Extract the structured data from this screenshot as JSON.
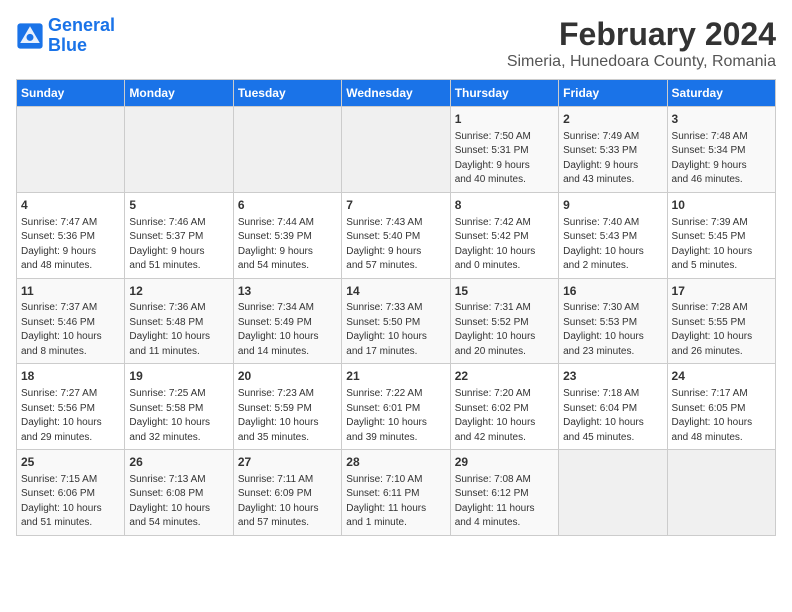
{
  "header": {
    "logo_line1": "General",
    "logo_line2": "Blue",
    "title": "February 2024",
    "subtitle": "Simeria, Hunedoara County, Romania"
  },
  "weekdays": [
    "Sunday",
    "Monday",
    "Tuesday",
    "Wednesday",
    "Thursday",
    "Friday",
    "Saturday"
  ],
  "weeks": [
    [
      {
        "day": "",
        "info": ""
      },
      {
        "day": "",
        "info": ""
      },
      {
        "day": "",
        "info": ""
      },
      {
        "day": "",
        "info": ""
      },
      {
        "day": "1",
        "info": "Sunrise: 7:50 AM\nSunset: 5:31 PM\nDaylight: 9 hours\nand 40 minutes."
      },
      {
        "day": "2",
        "info": "Sunrise: 7:49 AM\nSunset: 5:33 PM\nDaylight: 9 hours\nand 43 minutes."
      },
      {
        "day": "3",
        "info": "Sunrise: 7:48 AM\nSunset: 5:34 PM\nDaylight: 9 hours\nand 46 minutes."
      }
    ],
    [
      {
        "day": "4",
        "info": "Sunrise: 7:47 AM\nSunset: 5:36 PM\nDaylight: 9 hours\nand 48 minutes."
      },
      {
        "day": "5",
        "info": "Sunrise: 7:46 AM\nSunset: 5:37 PM\nDaylight: 9 hours\nand 51 minutes."
      },
      {
        "day": "6",
        "info": "Sunrise: 7:44 AM\nSunset: 5:39 PM\nDaylight: 9 hours\nand 54 minutes."
      },
      {
        "day": "7",
        "info": "Sunrise: 7:43 AM\nSunset: 5:40 PM\nDaylight: 9 hours\nand 57 minutes."
      },
      {
        "day": "8",
        "info": "Sunrise: 7:42 AM\nSunset: 5:42 PM\nDaylight: 10 hours\nand 0 minutes."
      },
      {
        "day": "9",
        "info": "Sunrise: 7:40 AM\nSunset: 5:43 PM\nDaylight: 10 hours\nand 2 minutes."
      },
      {
        "day": "10",
        "info": "Sunrise: 7:39 AM\nSunset: 5:45 PM\nDaylight: 10 hours\nand 5 minutes."
      }
    ],
    [
      {
        "day": "11",
        "info": "Sunrise: 7:37 AM\nSunset: 5:46 PM\nDaylight: 10 hours\nand 8 minutes."
      },
      {
        "day": "12",
        "info": "Sunrise: 7:36 AM\nSunset: 5:48 PM\nDaylight: 10 hours\nand 11 minutes."
      },
      {
        "day": "13",
        "info": "Sunrise: 7:34 AM\nSunset: 5:49 PM\nDaylight: 10 hours\nand 14 minutes."
      },
      {
        "day": "14",
        "info": "Sunrise: 7:33 AM\nSunset: 5:50 PM\nDaylight: 10 hours\nand 17 minutes."
      },
      {
        "day": "15",
        "info": "Sunrise: 7:31 AM\nSunset: 5:52 PM\nDaylight: 10 hours\nand 20 minutes."
      },
      {
        "day": "16",
        "info": "Sunrise: 7:30 AM\nSunset: 5:53 PM\nDaylight: 10 hours\nand 23 minutes."
      },
      {
        "day": "17",
        "info": "Sunrise: 7:28 AM\nSunset: 5:55 PM\nDaylight: 10 hours\nand 26 minutes."
      }
    ],
    [
      {
        "day": "18",
        "info": "Sunrise: 7:27 AM\nSunset: 5:56 PM\nDaylight: 10 hours\nand 29 minutes."
      },
      {
        "day": "19",
        "info": "Sunrise: 7:25 AM\nSunset: 5:58 PM\nDaylight: 10 hours\nand 32 minutes."
      },
      {
        "day": "20",
        "info": "Sunrise: 7:23 AM\nSunset: 5:59 PM\nDaylight: 10 hours\nand 35 minutes."
      },
      {
        "day": "21",
        "info": "Sunrise: 7:22 AM\nSunset: 6:01 PM\nDaylight: 10 hours\nand 39 minutes."
      },
      {
        "day": "22",
        "info": "Sunrise: 7:20 AM\nSunset: 6:02 PM\nDaylight: 10 hours\nand 42 minutes."
      },
      {
        "day": "23",
        "info": "Sunrise: 7:18 AM\nSunset: 6:04 PM\nDaylight: 10 hours\nand 45 minutes."
      },
      {
        "day": "24",
        "info": "Sunrise: 7:17 AM\nSunset: 6:05 PM\nDaylight: 10 hours\nand 48 minutes."
      }
    ],
    [
      {
        "day": "25",
        "info": "Sunrise: 7:15 AM\nSunset: 6:06 PM\nDaylight: 10 hours\nand 51 minutes."
      },
      {
        "day": "26",
        "info": "Sunrise: 7:13 AM\nSunset: 6:08 PM\nDaylight: 10 hours\nand 54 minutes."
      },
      {
        "day": "27",
        "info": "Sunrise: 7:11 AM\nSunset: 6:09 PM\nDaylight: 10 hours\nand 57 minutes."
      },
      {
        "day": "28",
        "info": "Sunrise: 7:10 AM\nSunset: 6:11 PM\nDaylight: 11 hours\nand 1 minute."
      },
      {
        "day": "29",
        "info": "Sunrise: 7:08 AM\nSunset: 6:12 PM\nDaylight: 11 hours\nand 4 minutes."
      },
      {
        "day": "",
        "info": ""
      },
      {
        "day": "",
        "info": ""
      }
    ]
  ]
}
